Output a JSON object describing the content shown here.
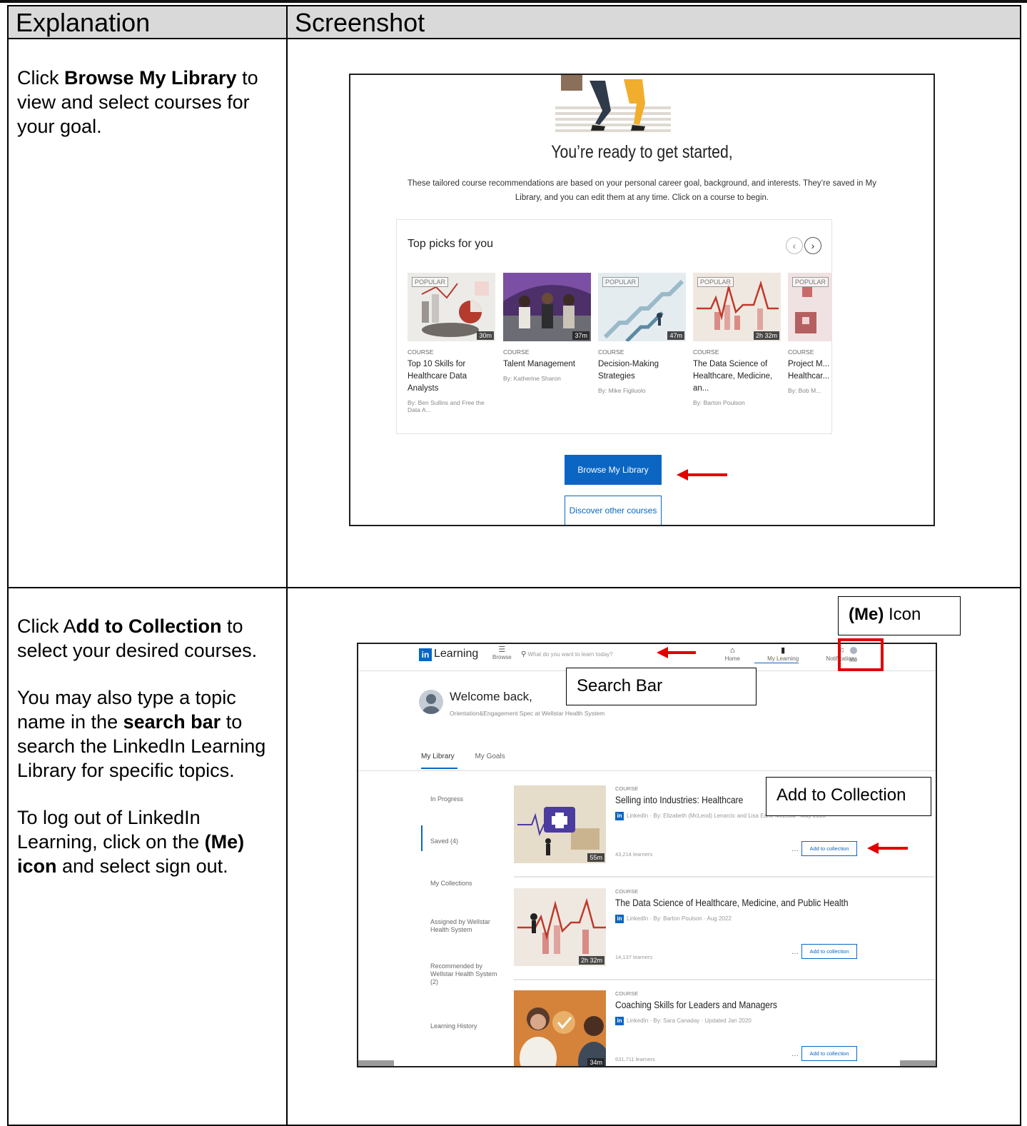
{
  "headers": {
    "explanation": "Explanation",
    "screenshot": "Screenshot"
  },
  "row1": {
    "explanation": {
      "pre": "Click ",
      "bold": "Browse My Library",
      "post": " to view and select courses for your goal."
    },
    "screenshot": {
      "heading": "You’re ready to get started,",
      "subtext": "These tailored course recommendations are based on your personal career goal, background, and interests. They’re saved in My Library, and you can edit them at any time. Click on a course to begin.",
      "top_picks_title": "Top picks for you",
      "courses": [
        {
          "badge": "POPULAR",
          "duration": "30m",
          "type": "COURSE",
          "title": "Top 10 Skills for Healthcare Data Analysts",
          "author": "By: Ben Sullins and Free the Data A..."
        },
        {
          "badge": "",
          "duration": "37m",
          "type": "COURSE",
          "title": "Talent Management",
          "author": "By: Katherine Sharon"
        },
        {
          "badge": "POPULAR",
          "duration": "47m",
          "type": "COURSE",
          "title": "Decision-Making Strategies",
          "author": "By: Mike Figliuolo"
        },
        {
          "badge": "POPULAR",
          "duration": "2h 32m",
          "type": "COURSE",
          "title": "The Data Science of Healthcare, Medicine, an...",
          "author": "By: Barton Poulson"
        },
        {
          "badge": "POPULAR",
          "duration": "",
          "type": "COURSE",
          "title": "Project M... Healthcar...",
          "author": "By: Bob M..."
        }
      ],
      "browse_button": "Browse My Library",
      "discover_button": "Discover other courses"
    }
  },
  "row2": {
    "explanation": {
      "p1_pre": "Click A",
      "p1_bold": "dd to Collection",
      "p1_post": " to select your desired courses.",
      "p2_pre": "You may also type a topic name in the ",
      "p2_bold": "search bar",
      "p2_post": " to search the LinkedIn Learning Library for specific topics.",
      "p3_pre": "To log out of LinkedIn Learning, click on the ",
      "p3_bold": "(Me) icon",
      "p3_post": " and select sign out."
    },
    "callouts": {
      "me_bold": "(Me)",
      "me_rest": " Icon",
      "search_bar": "Search Bar",
      "add_to_collection": "Add to Collection"
    },
    "screenshot": {
      "brand": "Learning",
      "browse_label": "Browse",
      "search_placeholder": "What do you want to learn today?",
      "nav": [
        "Home",
        "My Learning",
        "Notifications",
        "Me"
      ],
      "welcome": "Welcome back,",
      "welcome_sub": "Orientation&Engagement Spec at Wellstar Health System",
      "tabs": [
        "My Library",
        "My Goals"
      ],
      "sidebar": [
        "In Progress",
        "Saved (4)",
        "My Collections",
        "Assigned by Wellstar Health System",
        "Recommended by Wellstar Health System (2)",
        "Learning History"
      ],
      "courses": [
        {
          "type": "COURSE",
          "title": "Selling into Industries: Healthcare",
          "meta": "LinkedIn · By: Elizabeth (McLeod) Lenarcic and Lisa Earle McLeod · May 2018",
          "learners": "43,214 learners",
          "duration": "55m",
          "button": "Add to collection"
        },
        {
          "type": "COURSE",
          "title": "The Data Science of Healthcare, Medicine, and Public Health",
          "meta": "LinkedIn · By: Barton Poulson · Aug 2022",
          "learners": "14,137 learners",
          "duration": "2h 32m",
          "button": "Add to collection"
        },
        {
          "type": "COURSE",
          "title": "Coaching Skills for Leaders and Managers",
          "meta": "LinkedIn · By: Sara Canaday · Updated Jan 2020",
          "learners": "631,711 learners",
          "duration": "34m",
          "button": "Add to collection"
        }
      ]
    }
  },
  "colors": {
    "accent": "#0a66c2",
    "annotation_red": "#e10000",
    "header_gray": "#d9d9d9"
  }
}
